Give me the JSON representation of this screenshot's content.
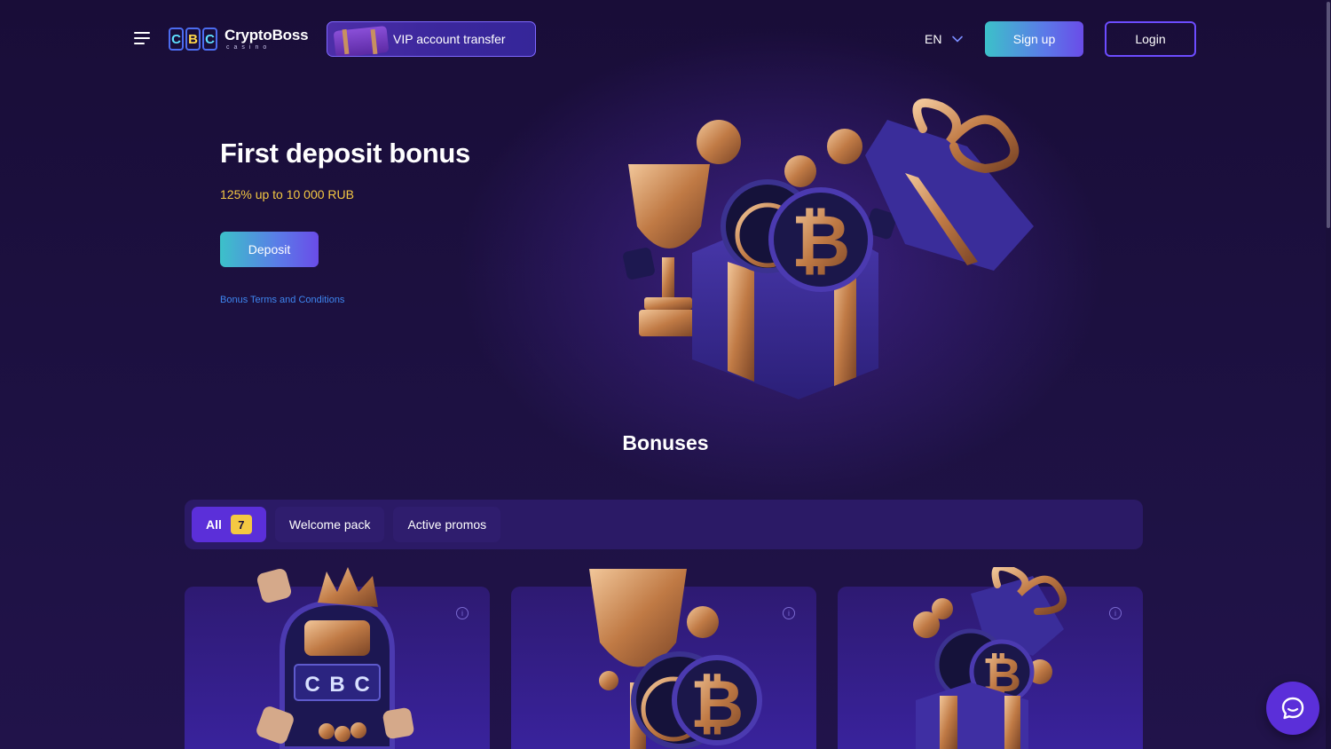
{
  "header": {
    "logo_name": "CryptoBoss",
    "logo_sub": "casino",
    "logo_tiles": [
      "C",
      "B",
      "C"
    ],
    "vip_label": "VIP account transfer",
    "language": "EN",
    "signup_label": "Sign up",
    "login_label": "Login"
  },
  "hero": {
    "title": "First deposit bonus",
    "subtitle": "125% up to 10 000 RUB",
    "deposit_label": "Deposit",
    "terms_label": "Bonus Terms and Conditions"
  },
  "bonuses": {
    "title": "Bonuses",
    "tabs": [
      {
        "label": "All",
        "count": "7"
      },
      {
        "label": "Welcome pack"
      },
      {
        "label": "Active promos"
      }
    ],
    "slot_reels": [
      "C",
      "B",
      "C"
    ]
  },
  "colors": {
    "background": "#1a0f3a",
    "accent": "#5b2fd9",
    "gold": "#f5c842",
    "link": "#3e86f0",
    "teal_gradient_start": "#3cc1c9"
  }
}
